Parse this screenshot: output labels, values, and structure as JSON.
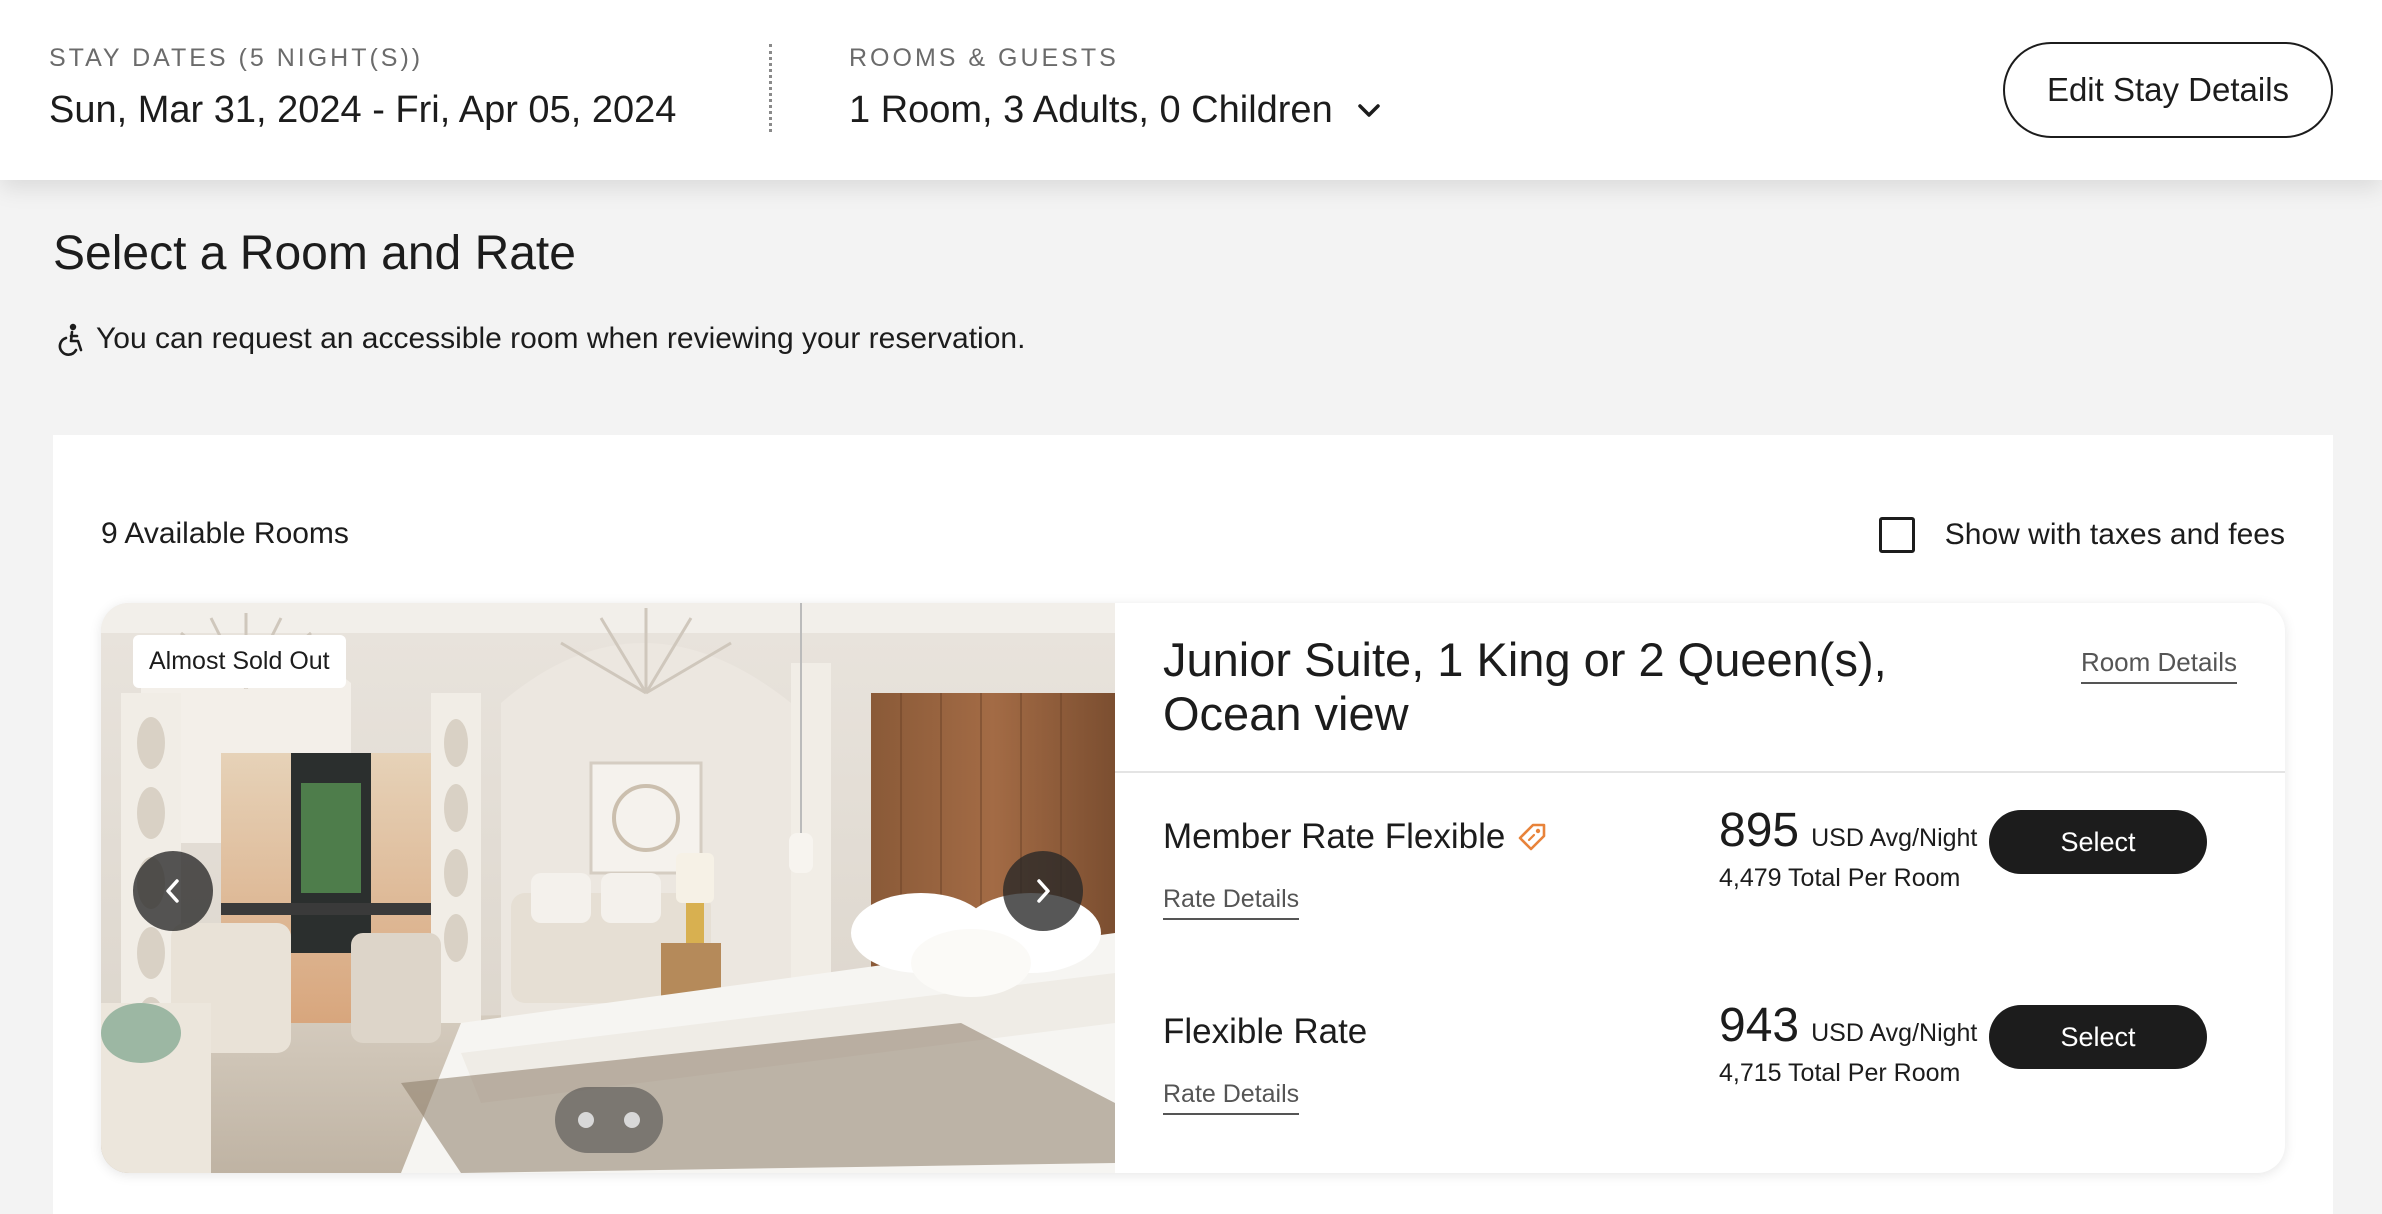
{
  "stay": {
    "dates_label": "STAY DATES (5 NIGHT(S))",
    "dates_value": "Sun, Mar 31, 2024 - Fri, Apr 05, 2024",
    "rooms_label": "ROOMS & GUESTS",
    "rooms_value": "1 Room, 3 Adults, 0 Children",
    "edit_button": "Edit Stay Details"
  },
  "page": {
    "title": "Select a Room and Rate",
    "accessible_note": "You can request an accessible room when reviewing your reservation."
  },
  "results": {
    "available_count": "9 Available Rooms",
    "taxes_toggle_label": "Show with taxes and fees",
    "taxes_toggle_checked": false
  },
  "room": {
    "badge": "Almost Sold Out",
    "title": "Junior Suite, 1 King or 2 Queen(s), Ocean view",
    "details_link": "Room Details",
    "carousel_dots": 2,
    "rates": [
      {
        "name": "Member Rate Flexible",
        "has_member_tag": true,
        "details_link": "Rate Details",
        "price": "895",
        "unit": "USD Avg/Night",
        "total": "4,479 Total Per Room",
        "button": "Select"
      },
      {
        "name": "Flexible Rate",
        "has_member_tag": false,
        "details_link": "Rate Details",
        "price": "943",
        "unit": "USD Avg/Night",
        "total": "4,715 Total Per Room",
        "button": "Select"
      }
    ]
  },
  "icons": {
    "chevron": "chevron-down-icon",
    "accessible": "wheelchair-icon",
    "member_tag": "tag-icon",
    "prev": "chevron-left-icon",
    "next": "chevron-right-icon"
  },
  "colors": {
    "text": "#1c1c1c",
    "button_bg": "#1c1c1c",
    "member_tag": "#e8833a",
    "page_bg": "#f3f3f3"
  }
}
